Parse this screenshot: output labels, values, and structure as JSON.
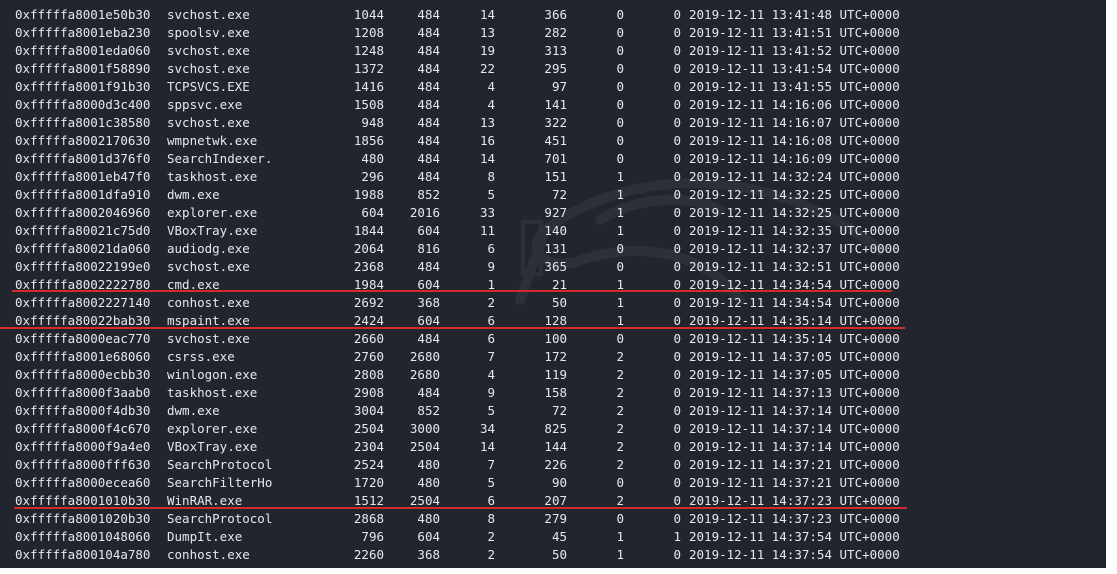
{
  "colors": {
    "terminal_bg": "#22252e",
    "text": "#e6e8ec",
    "highlight_line": "#d42a2a",
    "page_bg": "#ffffff"
  },
  "watermark_icon": "kali-dragon-logo",
  "rows": [
    {
      "offset": "0xfffffa8001e50b30",
      "name": "svchost.exe",
      "pid": "1044",
      "ppid": "484",
      "thds": "14",
      "hnds": "366",
      "sess": "0",
      "wow64": "0",
      "start": "2019-12-11 13:41:48 UTC+0000"
    },
    {
      "offset": "0xfffffa8001eba230",
      "name": "spoolsv.exe",
      "pid": "1208",
      "ppid": "484",
      "thds": "13",
      "hnds": "282",
      "sess": "0",
      "wow64": "0",
      "start": "2019-12-11 13:41:51 UTC+0000"
    },
    {
      "offset": "0xfffffa8001eda060",
      "name": "svchost.exe",
      "pid": "1248",
      "ppid": "484",
      "thds": "19",
      "hnds": "313",
      "sess": "0",
      "wow64": "0",
      "start": "2019-12-11 13:41:52 UTC+0000"
    },
    {
      "offset": "0xfffffa8001f58890",
      "name": "svchost.exe",
      "pid": "1372",
      "ppid": "484",
      "thds": "22",
      "hnds": "295",
      "sess": "0",
      "wow64": "0",
      "start": "2019-12-11 13:41:54 UTC+0000"
    },
    {
      "offset": "0xfffffa8001f91b30",
      "name": "TCPSVCS.EXE",
      "pid": "1416",
      "ppid": "484",
      "thds": "4",
      "hnds": "97",
      "sess": "0",
      "wow64": "0",
      "start": "2019-12-11 13:41:55 UTC+0000"
    },
    {
      "offset": "0xfffffa8000d3c400",
      "name": "sppsvc.exe",
      "pid": "1508",
      "ppid": "484",
      "thds": "4",
      "hnds": "141",
      "sess": "0",
      "wow64": "0",
      "start": "2019-12-11 14:16:06 UTC+0000"
    },
    {
      "offset": "0xfffffa8001c38580",
      "name": "svchost.exe",
      "pid": "948",
      "ppid": "484",
      "thds": "13",
      "hnds": "322",
      "sess": "0",
      "wow64": "0",
      "start": "2019-12-11 14:16:07 UTC+0000"
    },
    {
      "offset": "0xfffffa8002170630",
      "name": "wmpnetwk.exe",
      "pid": "1856",
      "ppid": "484",
      "thds": "16",
      "hnds": "451",
      "sess": "0",
      "wow64": "0",
      "start": "2019-12-11 14:16:08 UTC+0000"
    },
    {
      "offset": "0xfffffa8001d376f0",
      "name": "SearchIndexer.",
      "pid": "480",
      "ppid": "484",
      "thds": "14",
      "hnds": "701",
      "sess": "0",
      "wow64": "0",
      "start": "2019-12-11 14:16:09 UTC+0000"
    },
    {
      "offset": "0xfffffa8001eb47f0",
      "name": "taskhost.exe",
      "pid": "296",
      "ppid": "484",
      "thds": "8",
      "hnds": "151",
      "sess": "1",
      "wow64": "0",
      "start": "2019-12-11 14:32:24 UTC+0000"
    },
    {
      "offset": "0xfffffa8001dfa910",
      "name": "dwm.exe",
      "pid": "1988",
      "ppid": "852",
      "thds": "5",
      "hnds": "72",
      "sess": "1",
      "wow64": "0",
      "start": "2019-12-11 14:32:25 UTC+0000"
    },
    {
      "offset": "0xfffffa8002046960",
      "name": "explorer.exe",
      "pid": "604",
      "ppid": "2016",
      "thds": "33",
      "hnds": "927",
      "sess": "1",
      "wow64": "0",
      "start": "2019-12-11 14:32:25 UTC+0000"
    },
    {
      "offset": "0xfffffa80021c75d0",
      "name": "VBoxTray.exe",
      "pid": "1844",
      "ppid": "604",
      "thds": "11",
      "hnds": "140",
      "sess": "1",
      "wow64": "0",
      "start": "2019-12-11 14:32:35 UTC+0000"
    },
    {
      "offset": "0xfffffa80021da060",
      "name": "audiodg.exe",
      "pid": "2064",
      "ppid": "816",
      "thds": "6",
      "hnds": "131",
      "sess": "0",
      "wow64": "0",
      "start": "2019-12-11 14:32:37 UTC+0000"
    },
    {
      "offset": "0xfffffa80022199e0",
      "name": "svchost.exe",
      "pid": "2368",
      "ppid": "484",
      "thds": "9",
      "hnds": "365",
      "sess": "0",
      "wow64": "0",
      "start": "2019-12-11 14:32:51 UTC+0000"
    },
    {
      "offset": "0xfffffa8002222780",
      "name": "cmd.exe",
      "pid": "1984",
      "ppid": "604",
      "thds": "1",
      "hnds": "21",
      "sess": "1",
      "wow64": "0",
      "start": "2019-12-11 14:34:54 UTC+0000"
    },
    {
      "offset": "0xfffffa8002227140",
      "name": "conhost.exe",
      "pid": "2692",
      "ppid": "368",
      "thds": "2",
      "hnds": "50",
      "sess": "1",
      "wow64": "0",
      "start": "2019-12-11 14:34:54 UTC+0000"
    },
    {
      "offset": "0xfffffa80022bab30",
      "name": "mspaint.exe",
      "pid": "2424",
      "ppid": "604",
      "thds": "6",
      "hnds": "128",
      "sess": "1",
      "wow64": "0",
      "start": "2019-12-11 14:35:14 UTC+0000"
    },
    {
      "offset": "0xfffffa8000eac770",
      "name": "svchost.exe",
      "pid": "2660",
      "ppid": "484",
      "thds": "6",
      "hnds": "100",
      "sess": "0",
      "wow64": "0",
      "start": "2019-12-11 14:35:14 UTC+0000"
    },
    {
      "offset": "0xfffffa8001e68060",
      "name": "csrss.exe",
      "pid": "2760",
      "ppid": "2680",
      "thds": "7",
      "hnds": "172",
      "sess": "2",
      "wow64": "0",
      "start": "2019-12-11 14:37:05 UTC+0000"
    },
    {
      "offset": "0xfffffa8000ecbb30",
      "name": "winlogon.exe",
      "pid": "2808",
      "ppid": "2680",
      "thds": "4",
      "hnds": "119",
      "sess": "2",
      "wow64": "0",
      "start": "2019-12-11 14:37:05 UTC+0000"
    },
    {
      "offset": "0xfffffa8000f3aab0",
      "name": "taskhost.exe",
      "pid": "2908",
      "ppid": "484",
      "thds": "9",
      "hnds": "158",
      "sess": "2",
      "wow64": "0",
      "start": "2019-12-11 14:37:13 UTC+0000"
    },
    {
      "offset": "0xfffffa8000f4db30",
      "name": "dwm.exe",
      "pid": "3004",
      "ppid": "852",
      "thds": "5",
      "hnds": "72",
      "sess": "2",
      "wow64": "0",
      "start": "2019-12-11 14:37:14 UTC+0000"
    },
    {
      "offset": "0xfffffa8000f4c670",
      "name": "explorer.exe",
      "pid": "2504",
      "ppid": "3000",
      "thds": "34",
      "hnds": "825",
      "sess": "2",
      "wow64": "0",
      "start": "2019-12-11 14:37:14 UTC+0000"
    },
    {
      "offset": "0xfffffa8000f9a4e0",
      "name": "VBoxTray.exe",
      "pid": "2304",
      "ppid": "2504",
      "thds": "14",
      "hnds": "144",
      "sess": "2",
      "wow64": "0",
      "start": "2019-12-11 14:37:14 UTC+0000"
    },
    {
      "offset": "0xfffffa8000fff630",
      "name": "SearchProtocol",
      "pid": "2524",
      "ppid": "480",
      "thds": "7",
      "hnds": "226",
      "sess": "2",
      "wow64": "0",
      "start": "2019-12-11 14:37:21 UTC+0000"
    },
    {
      "offset": "0xfffffa8000ecea60",
      "name": "SearchFilterHo",
      "pid": "1720",
      "ppid": "480",
      "thds": "5",
      "hnds": "90",
      "sess": "0",
      "wow64": "0",
      "start": "2019-12-11 14:37:21 UTC+0000"
    },
    {
      "offset": "0xfffffa8001010b30",
      "name": "WinRAR.exe",
      "pid": "1512",
      "ppid": "2504",
      "thds": "6",
      "hnds": "207",
      "sess": "2",
      "wow64": "0",
      "start": "2019-12-11 14:37:23 UTC+0000"
    },
    {
      "offset": "0xfffffa8001020b30",
      "name": "SearchProtocol",
      "pid": "2868",
      "ppid": "480",
      "thds": "8",
      "hnds": "279",
      "sess": "0",
      "wow64": "0",
      "start": "2019-12-11 14:37:23 UTC+0000"
    },
    {
      "offset": "0xfffffa8001048060",
      "name": "DumpIt.exe",
      "pid": "796",
      "ppid": "604",
      "thds": "2",
      "hnds": "45",
      "sess": "1",
      "wow64": "1",
      "start": "2019-12-11 14:37:54 UTC+0000"
    },
    {
      "offset": "0xfffffa800104a780",
      "name": "conhost.exe",
      "pid": "2260",
      "ppid": "368",
      "thds": "2",
      "hnds": "50",
      "sess": "1",
      "wow64": "0",
      "start": "2019-12-11 14:37:54 UTC+0000"
    }
  ]
}
